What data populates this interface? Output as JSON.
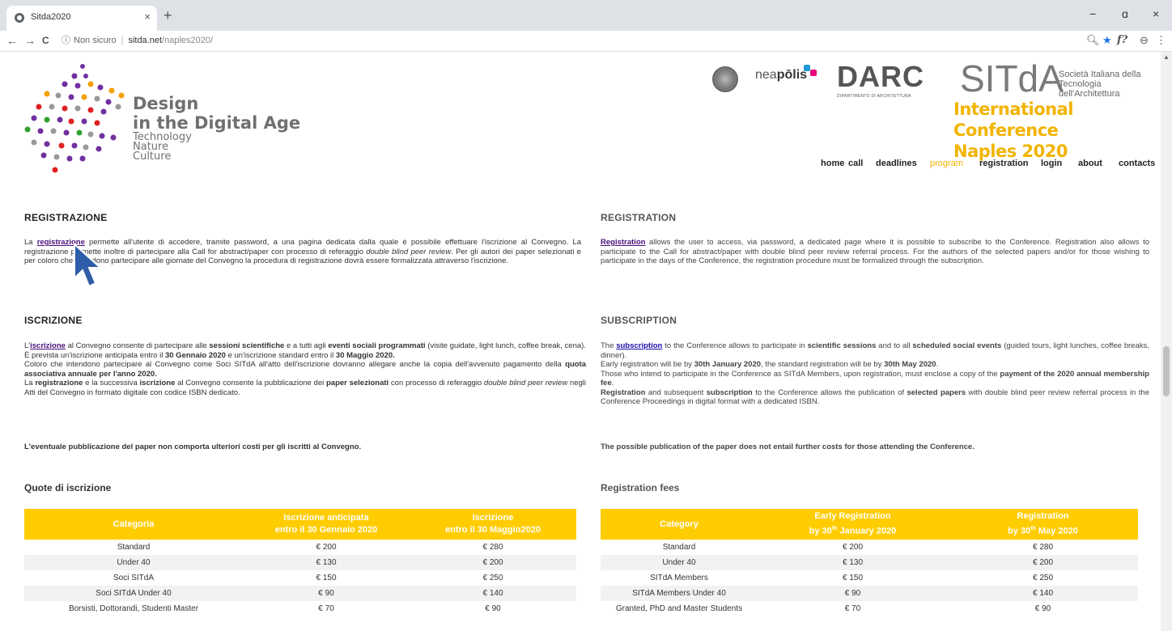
{
  "browser": {
    "tab_title": "Sitda2020",
    "tab_close": "×",
    "new_tab": "+",
    "minimize": "−",
    "maximize": "ɑ",
    "close": "×",
    "back": "←",
    "forward": "→",
    "reload": "C",
    "security": "Non sicuro",
    "url_host": "sitda.net",
    "url_path": "/naples2020/"
  },
  "logo": {
    "title_1": "Design",
    "title_2": "in the Digital Age",
    "sub_1": "Technology",
    "sub_2": "Nature",
    "sub_3": "Culture"
  },
  "header": {
    "neapolis_a": "nea",
    "neapolis_b": "pōlis",
    "diarc": "DARC",
    "diarc_sub": "DIPARTIMENTO DI ARCHITETTURA",
    "sitda": "SITdA",
    "sitda_desc_1": "Società Italiana della",
    "sitda_desc_2": "Tecnologia dell'Architettura",
    "conf_1": "International Conference",
    "conf_2": "Naples 2020"
  },
  "nav": {
    "home": "home",
    "call": "call",
    "deadlines": "deadlines",
    "program": "program",
    "registration": "registration",
    "login": "login",
    "about": "about",
    "contacts": "contacts"
  },
  "it": {
    "reg_heading": "REGISTRAZIONE",
    "reg_link": "registrazione",
    "sub_heading": "ISCRIZIONE",
    "sub_link": "iscrizione",
    "fees_heading": "Quote di iscrizione",
    "closing": "L'eventuale pubblicazione del paper non comporta ulteriori costi per gli iscritti al Convegno."
  },
  "en": {
    "reg_heading": "REGISTRATION",
    "reg_link": "Registration",
    "sub_heading": "SUBSCRIPTION",
    "sub_link": "subscription",
    "fees_heading": "Registration fees",
    "closing": "The possible publication of the paper does not entail further costs for those attending the Conference."
  },
  "table_it": {
    "headers": [
      "Categoria",
      "Iscrizione anticipata",
      "entro il 30 Gennaio 2020",
      "Iscrizione",
      "entro il 30 Maggio2020"
    ],
    "rows": [
      [
        "Standard",
        "€ 200",
        "€ 280"
      ],
      [
        "Under 40",
        "€ 130",
        "€ 200"
      ],
      [
        "Soci SITdA",
        "€ 150",
        "€ 250"
      ],
      [
        "Soci SITdA Under 40",
        "€ 90",
        "€ 140"
      ],
      [
        "Borsisti, Dottorandi, Studenti Master",
        "€ 70",
        "€ 90"
      ]
    ]
  },
  "table_en": {
    "headers": [
      "Category",
      "Early Registration",
      "by 30",
      "th",
      " January 2020",
      "Registration",
      "by 30",
      "th",
      " May 2020"
    ],
    "rows": [
      [
        "Standard",
        "€ 200",
        "€ 280"
      ],
      [
        "Under 40",
        "€ 130",
        "€ 200"
      ],
      [
        "SITdA Members",
        "€ 150",
        "€ 250"
      ],
      [
        "SITdA Members Under 40",
        "€ 90",
        "€ 140"
      ],
      [
        "Granted, PhD and Master Students",
        "€ 70",
        "€ 90"
      ]
    ]
  },
  "colors": {
    "accent_yellow": "#ffcc00",
    "conference_title": "#f2b400",
    "link_purple": "#4b0f7a",
    "cursor_blue": "#2f5ea8"
  }
}
